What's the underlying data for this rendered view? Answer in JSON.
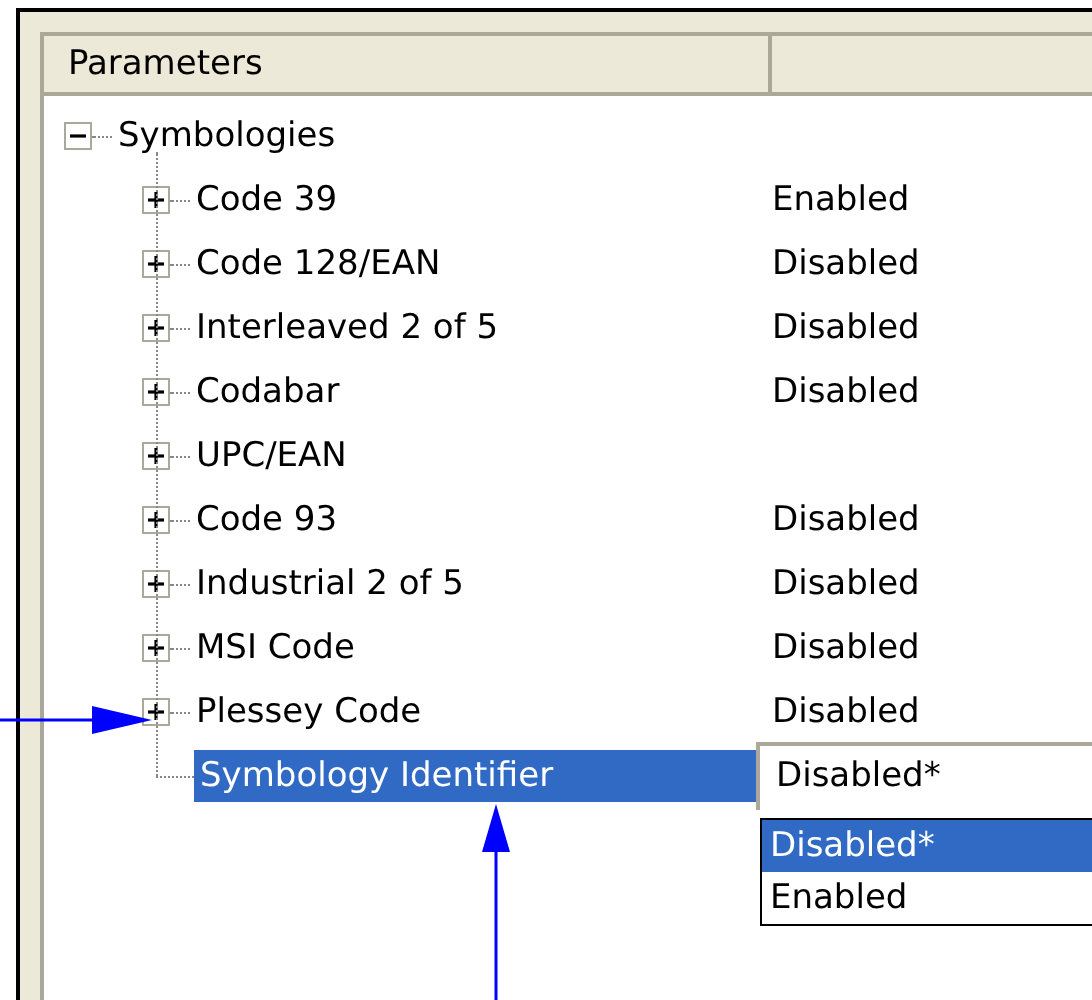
{
  "header": {
    "columns": [
      "Parameters"
    ]
  },
  "tree": {
    "label": "Symbologies",
    "expanded": true,
    "children": [
      {
        "kind": "group",
        "label": "Code 39",
        "value": "Enabled",
        "expanded": false,
        "selected": false
      },
      {
        "kind": "group",
        "label": "Code 128/EAN",
        "value": "Disabled",
        "expanded": false,
        "selected": false
      },
      {
        "kind": "group",
        "label": "Interleaved 2 of 5",
        "value": "Disabled",
        "expanded": false,
        "selected": false
      },
      {
        "kind": "group",
        "label": "Codabar",
        "value": "Disabled",
        "expanded": false,
        "selected": false
      },
      {
        "kind": "group",
        "label": "UPC/EAN",
        "expanded": false,
        "selected": false
      },
      {
        "kind": "group",
        "label": "Code 93",
        "value": "Disabled",
        "expanded": false,
        "selected": false
      },
      {
        "kind": "group",
        "label": "Industrial 2 of 5",
        "value": "Disabled",
        "expanded": false,
        "selected": false
      },
      {
        "kind": "group",
        "label": "MSI Code",
        "value": "Disabled",
        "expanded": false,
        "selected": false
      },
      {
        "kind": "group",
        "label": "Plessey Code",
        "value": "Disabled",
        "expanded": false,
        "selected": false
      },
      {
        "kind": "setting",
        "label": "Symbology Identifier",
        "selected": true,
        "editor": {
          "value": "Disabled*",
          "options": [
            {
              "label": "Disabled*",
              "selected": true
            },
            {
              "label": "Enabled",
              "selected": false
            }
          ]
        }
      }
    ]
  }
}
